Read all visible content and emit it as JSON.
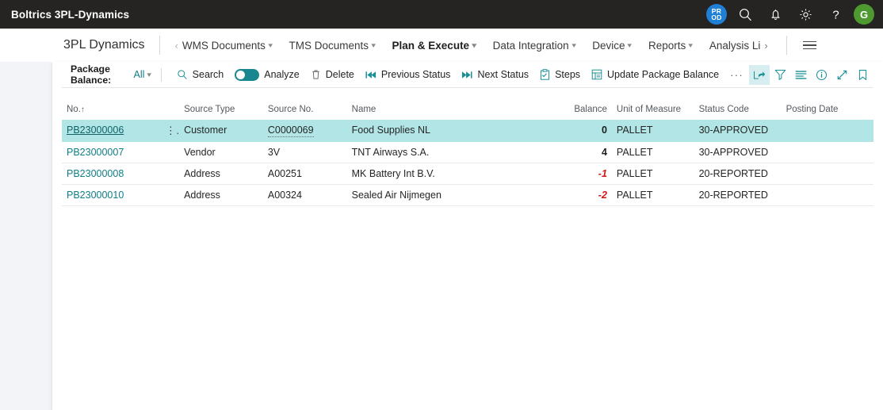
{
  "topbar": {
    "title": "Boltrics 3PL-Dynamics",
    "environment_badge": {
      "line1": "PR",
      "line2": "OD",
      "color": "#1f7fd4"
    },
    "icons": [
      "search-icon",
      "notification-bell-icon",
      "settings-gear-icon",
      "help-question-icon"
    ],
    "avatar_initial": "G",
    "avatar_color": "#4e9a30"
  },
  "nav": {
    "app_name": "3PL Dynamics",
    "items": [
      {
        "label": "WMS Documents",
        "has_left_chevron": true,
        "has_dropdown": true,
        "active": false
      },
      {
        "label": "TMS Documents",
        "has_left_chevron": false,
        "has_dropdown": true,
        "active": false
      },
      {
        "label": "Plan & Execute",
        "has_left_chevron": false,
        "has_dropdown": true,
        "active": true
      },
      {
        "label": "Data Integration",
        "has_left_chevron": false,
        "has_dropdown": true,
        "active": false
      },
      {
        "label": "Device",
        "has_left_chevron": false,
        "has_dropdown": true,
        "active": false
      },
      {
        "label": "Reports",
        "has_left_chevron": false,
        "has_dropdown": true,
        "active": false
      },
      {
        "label": "Analysis Li",
        "has_left_chevron": false,
        "has_dropdown": false,
        "has_right_chevron": true,
        "active": false
      }
    ],
    "menu_icon": "hamburger-menu-icon"
  },
  "toolbar": {
    "filter_label": "Package Balance:",
    "filter_value": "All",
    "search_label": "Search",
    "analyze_label": "Analyze",
    "analyze_toggle_on": true,
    "delete_label": "Delete",
    "previous_status_label": "Previous Status",
    "next_status_label": "Next Status",
    "steps_label": "Steps",
    "update_package_balance_label": "Update Package Balance",
    "overflow_label": "···",
    "right_icons": [
      {
        "name": "open-in-excel-icon",
        "selected": true
      },
      {
        "name": "filter-icon",
        "selected": false
      },
      {
        "name": "list-lines-icon",
        "selected": false
      },
      {
        "name": "info-icon",
        "selected": false
      },
      {
        "name": "expand-icon",
        "selected": false
      },
      {
        "name": "bookmark-icon",
        "selected": false
      }
    ],
    "accent_color": "#1a8f96"
  },
  "table": {
    "columns": [
      {
        "key": "no",
        "label": "No.",
        "sort": "↑",
        "align": "left"
      },
      {
        "key": "source_type",
        "label": "Source Type",
        "align": "left"
      },
      {
        "key": "source_no",
        "label": "Source No.",
        "align": "left"
      },
      {
        "key": "name",
        "label": "Name",
        "align": "left"
      },
      {
        "key": "balance",
        "label": "Balance",
        "align": "right"
      },
      {
        "key": "unit_of_measure",
        "label": "Unit of Measure",
        "align": "left"
      },
      {
        "key": "status_code",
        "label": "Status Code",
        "align": "left"
      },
      {
        "key": "posting_date",
        "label": "Posting Date",
        "align": "left"
      }
    ],
    "rows": [
      {
        "no": "PB23000006",
        "source_type": "Customer",
        "source_no": "C0000069",
        "name": "Food Supplies NL",
        "balance": "0",
        "balance_negative": false,
        "unit_of_measure": "PALLET",
        "status_code": "30-APPROVED",
        "posting_date": "",
        "selected": true
      },
      {
        "no": "PB23000007",
        "source_type": "Vendor",
        "source_no": "3V",
        "name": "TNT Airways S.A.",
        "balance": "4",
        "balance_negative": false,
        "unit_of_measure": "PALLET",
        "status_code": "30-APPROVED",
        "posting_date": "",
        "selected": false
      },
      {
        "no": "PB23000008",
        "source_type": "Address",
        "source_no": "A00251",
        "name": "MK Battery Int B.V.",
        "balance": "-1",
        "balance_negative": true,
        "unit_of_measure": "PALLET",
        "status_code": "20-REPORTED",
        "posting_date": "",
        "selected": false
      },
      {
        "no": "PB23000010",
        "source_type": "Address",
        "source_no": "A00324",
        "name": "Sealed Air Nijmegen",
        "balance": "-2",
        "balance_negative": true,
        "unit_of_measure": "PALLET",
        "status_code": "20-REPORTED",
        "posting_date": "",
        "selected": false
      }
    ],
    "row_menu_icon": "row-options-vertical-dots",
    "selected_row_color": "#b2e6e6"
  }
}
